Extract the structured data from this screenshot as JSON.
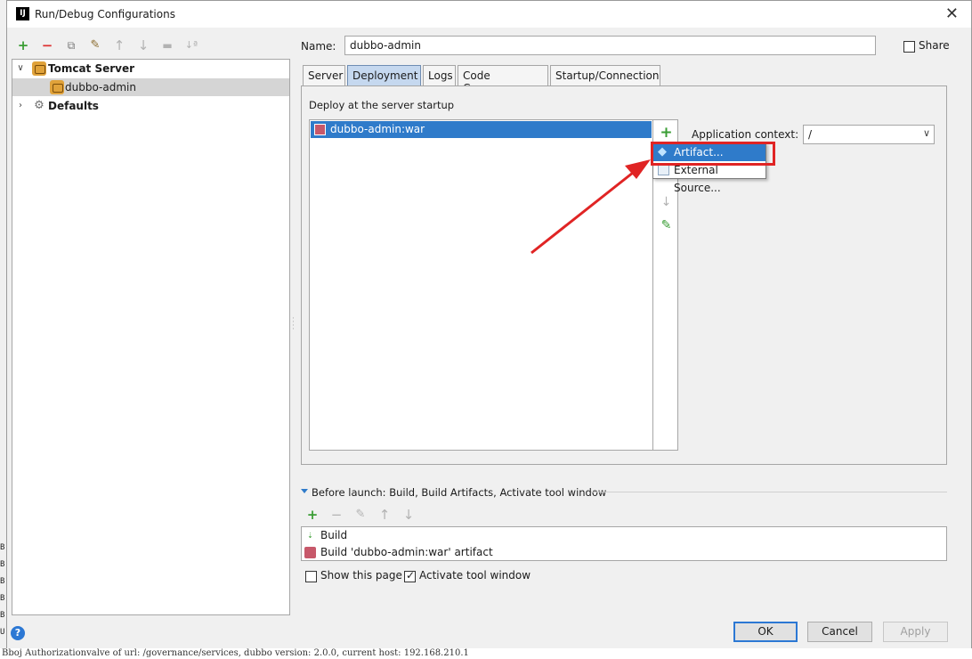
{
  "window": {
    "title": "Run/Debug Configurations",
    "app_icon_text": "IJ"
  },
  "tree": {
    "items": [
      {
        "label": "Tomcat Server"
      },
      {
        "label": "dubbo-admin"
      },
      {
        "label": "Defaults"
      }
    ]
  },
  "form": {
    "name_label": "Name:",
    "name_value": "dubbo-admin",
    "share_label": "Share"
  },
  "tabs": [
    "Server",
    "Deployment",
    "Logs",
    "Code Coverage",
    "Startup/Connection"
  ],
  "deployment": {
    "section_label": "Deploy at the server startup",
    "items": [
      "dubbo-admin:war"
    ],
    "context_label": "Application context:",
    "context_value": "/"
  },
  "popup": {
    "items": [
      "Artifact...",
      "External Source..."
    ]
  },
  "before_launch": {
    "label": "Before launch: Build, Build Artifacts, Activate tool window",
    "items": [
      "Build",
      "Build 'dubbo-admin:war' artifact"
    ],
    "show_page_label": "Show this page",
    "activate_label": "Activate tool window"
  },
  "buttons": {
    "ok": "OK",
    "cancel": "Cancel",
    "apply": "Apply"
  },
  "background_text": {
    "left_letters": [
      "B",
      "B",
      "B",
      "B",
      "B",
      "U"
    ],
    "bottom_line": "Bboj Authorizationvalve of url: /governance/services, dubbo version: 2.0.0, current host: 192.168.210.1"
  },
  "colors": {
    "selection": "#2f7bca",
    "annotation": "#e02424",
    "add": "#3a9d34"
  }
}
